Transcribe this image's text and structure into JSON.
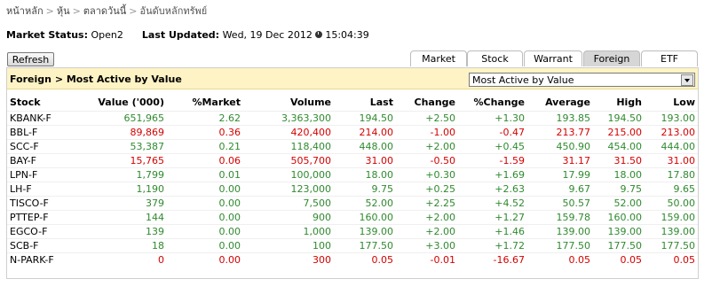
{
  "breadcrumb": [
    "หน้าหลัก",
    "หุ้น",
    "ตลาดวันนี้",
    "อันดับหลักทรัพย์"
  ],
  "status": {
    "market_status_label": "Market Status:",
    "market_status_value": "Open2",
    "last_updated_label": "Last Updated:",
    "last_updated_value": "Wed, 19 Dec 2012",
    "time": "15:04:39"
  },
  "refresh_label": "Refresh",
  "tabs": [
    {
      "label": "Market",
      "active": false
    },
    {
      "label": "Stock",
      "active": false
    },
    {
      "label": "Warrant",
      "active": false
    },
    {
      "label": "Foreign",
      "active": true
    },
    {
      "label": "ETF",
      "active": false
    }
  ],
  "panel_title": "Foreign > Most Active by Value",
  "dropdown_value": "Most Active by Value",
  "colors": {
    "up": "#2f8a2f",
    "down": "#d40000",
    "header_bg": "#fdf3c4"
  },
  "table": {
    "columns": [
      "Stock",
      "Value ('000)",
      "%Market",
      "Volume",
      "Last",
      "Change",
      "%Change",
      "Average",
      "High",
      "Low"
    ],
    "rows": [
      {
        "stock": "KBANK-F",
        "value": "651,965",
        "market": "2.62",
        "volume": "3,363,300",
        "last": "194.50",
        "change": "+2.50",
        "pchange": "+1.30",
        "avg": "193.85",
        "high": "194.50",
        "low": "193.00",
        "dir": "up"
      },
      {
        "stock": "BBL-F",
        "value": "89,869",
        "market": "0.36",
        "volume": "420,400",
        "last": "214.00",
        "change": "-1.00",
        "pchange": "-0.47",
        "avg": "213.77",
        "high": "215.00",
        "low": "213.00",
        "dir": "down"
      },
      {
        "stock": "SCC-F",
        "value": "53,387",
        "market": "0.21",
        "volume": "118,400",
        "last": "448.00",
        "change": "+2.00",
        "pchange": "+0.45",
        "avg": "450.90",
        "high": "454.00",
        "low": "444.00",
        "dir": "up"
      },
      {
        "stock": "BAY-F",
        "value": "15,765",
        "market": "0.06",
        "volume": "505,700",
        "last": "31.00",
        "change": "-0.50",
        "pchange": "-1.59",
        "avg": "31.17",
        "high": "31.50",
        "low": "31.00",
        "dir": "down"
      },
      {
        "stock": "LPN-F",
        "value": "1,799",
        "market": "0.01",
        "volume": "100,000",
        "last": "18.00",
        "change": "+0.30",
        "pchange": "+1.69",
        "avg": "17.99",
        "high": "18.00",
        "low": "17.80",
        "dir": "up"
      },
      {
        "stock": "LH-F",
        "value": "1,190",
        "market": "0.00",
        "volume": "123,000",
        "last": "9.75",
        "change": "+0.25",
        "pchange": "+2.63",
        "avg": "9.67",
        "high": "9.75",
        "low": "9.65",
        "dir": "up"
      },
      {
        "stock": "TISCO-F",
        "value": "379",
        "market": "0.00",
        "volume": "7,500",
        "last": "52.00",
        "change": "+2.25",
        "pchange": "+4.52",
        "avg": "50.57",
        "high": "52.00",
        "low": "50.00",
        "dir": "up"
      },
      {
        "stock": "PTTEP-F",
        "value": "144",
        "market": "0.00",
        "volume": "900",
        "last": "160.00",
        "change": "+2.00",
        "pchange": "+1.27",
        "avg": "159.78",
        "high": "160.00",
        "low": "159.00",
        "dir": "up"
      },
      {
        "stock": "EGCO-F",
        "value": "139",
        "market": "0.00",
        "volume": "1,000",
        "last": "139.00",
        "change": "+2.00",
        "pchange": "+1.46",
        "avg": "139.00",
        "high": "139.00",
        "low": "139.00",
        "dir": "up"
      },
      {
        "stock": "SCB-F",
        "value": "18",
        "market": "0.00",
        "volume": "100",
        "last": "177.50",
        "change": "+3.00",
        "pchange": "+1.72",
        "avg": "177.50",
        "high": "177.50",
        "low": "177.50",
        "dir": "up"
      },
      {
        "stock": "N-PARK-F",
        "value": "0",
        "market": "0.00",
        "volume": "300",
        "last": "0.05",
        "change": "-0.01",
        "pchange": "-16.67",
        "avg": "0.05",
        "high": "0.05",
        "low": "0.05",
        "dir": "down"
      }
    ]
  }
}
